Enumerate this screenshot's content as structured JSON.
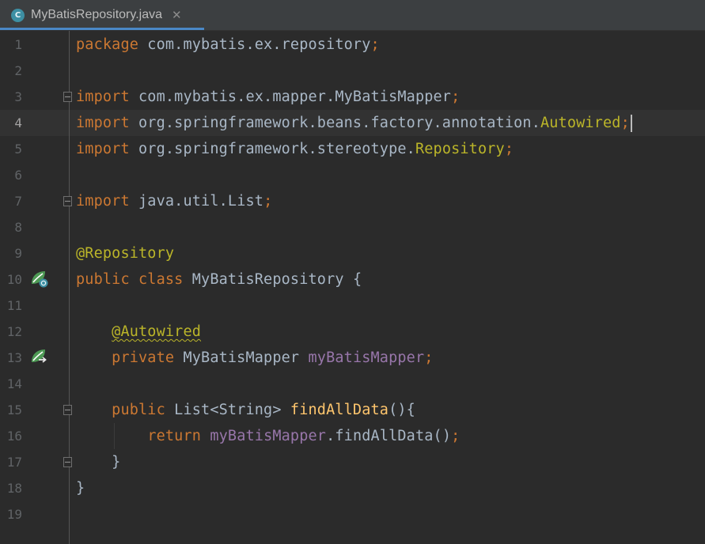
{
  "tab": {
    "file_name": "MyBatisRepository.java",
    "icon_letter": "C",
    "close_glyph": "✕"
  },
  "editor": {
    "current_line": 4,
    "line_numbers": [
      "1",
      "2",
      "3",
      "4",
      "5",
      "6",
      "7",
      "8",
      "9",
      "10",
      "11",
      "12",
      "13",
      "14",
      "15",
      "16",
      "17",
      "18",
      "19"
    ],
    "lines": [
      [
        {
          "t": "package",
          "c": "kw"
        },
        {
          "t": " com.mybatis.ex.repository",
          "c": "plain"
        },
        {
          "t": ";",
          "c": "kw"
        }
      ],
      [],
      [
        {
          "t": "import",
          "c": "kw"
        },
        {
          "t": " com.mybatis.ex.mapper.MyBatisMapper",
          "c": "plain"
        },
        {
          "t": ";",
          "c": "kw"
        }
      ],
      [
        {
          "t": "import",
          "c": "kw"
        },
        {
          "t": " org.springframework.beans.factory.annotation.",
          "c": "plain"
        },
        {
          "t": "Autowired",
          "c": "ann"
        },
        {
          "t": ";",
          "c": "kw"
        }
      ],
      [
        {
          "t": "import",
          "c": "kw"
        },
        {
          "t": " org.springframework.stereotype.",
          "c": "plain"
        },
        {
          "t": "Repository",
          "c": "ann"
        },
        {
          "t": ";",
          "c": "kw"
        }
      ],
      [],
      [
        {
          "t": "import",
          "c": "kw"
        },
        {
          "t": " java.util.List",
          "c": "plain"
        },
        {
          "t": ";",
          "c": "kw"
        }
      ],
      [],
      [
        {
          "t": "@Repository",
          "c": "ann"
        }
      ],
      [
        {
          "t": "public class",
          "c": "kw"
        },
        {
          "t": " MyBatisRepository {",
          "c": "plain"
        }
      ],
      [],
      [
        {
          "t": "    ",
          "c": "plain"
        },
        {
          "t": "@Autowired",
          "c": "ann squiggle"
        }
      ],
      [
        {
          "t": "    ",
          "c": "plain"
        },
        {
          "t": "private",
          "c": "kw"
        },
        {
          "t": " MyBatisMapper ",
          "c": "plain"
        },
        {
          "t": "myBatisMapper",
          "c": "field"
        },
        {
          "t": ";",
          "c": "kw"
        }
      ],
      [],
      [
        {
          "t": "    ",
          "c": "plain"
        },
        {
          "t": "public",
          "c": "kw"
        },
        {
          "t": " List<String> ",
          "c": "plain"
        },
        {
          "t": "findAllData",
          "c": "method"
        },
        {
          "t": "(){",
          "c": "plain"
        }
      ],
      [
        {
          "t": "        ",
          "c": "plain"
        },
        {
          "t": "return",
          "c": "kw"
        },
        {
          "t": " ",
          "c": "plain"
        },
        {
          "t": "myBatisMapper",
          "c": "field"
        },
        {
          "t": ".findAllData()",
          "c": "plain"
        },
        {
          "t": ";",
          "c": "kw"
        }
      ],
      [
        {
          "t": "    }",
          "c": "plain"
        }
      ],
      [
        {
          "t": "}",
          "c": "plain"
        }
      ],
      []
    ]
  },
  "gutter_icons": [
    {
      "line": 10,
      "name": "spring-bean-class-icon"
    },
    {
      "line": 13,
      "name": "spring-bean-injection-icon"
    }
  ],
  "fold_markers": [
    {
      "line": 3,
      "type": "open"
    },
    {
      "line": 7,
      "type": "close"
    },
    {
      "line": 15,
      "type": "open"
    },
    {
      "line": 17,
      "type": "close"
    }
  ],
  "colors": {
    "background": "#2b2b2b",
    "keyword": "#cc7832",
    "annotation": "#bbb529",
    "field": "#9876aa",
    "method": "#ffc66d",
    "text": "#a9b7c6",
    "tab_accent": "#4a88c7",
    "bean_icon": "#4e9a55"
  }
}
